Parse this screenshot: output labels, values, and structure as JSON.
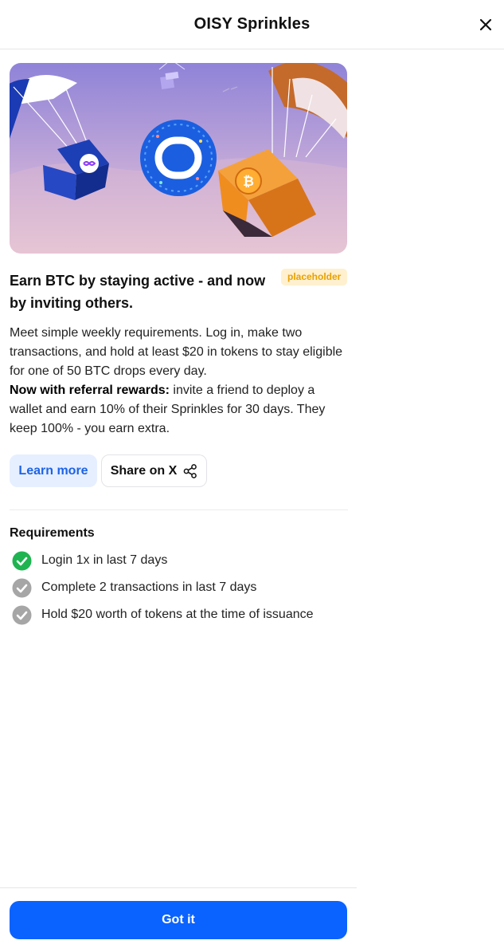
{
  "header": {
    "title": "OISY Sprinkles",
    "close_icon": "close-icon"
  },
  "hero": {
    "illustration": "parachuting-gift-boxes",
    "icons": [
      "internet-computer-logo",
      "oisy-logo",
      "bitcoin-logo"
    ]
  },
  "campaign": {
    "headline": "Earn BTC by staying active - and now by inviting others.",
    "badge": "placeholder",
    "description": "Meet simple weekly requirements. Log in, make two transactions, and hold at least $20 in tokens to stay eligible for one of 50 BTC drops every day.",
    "referral_bold": "Now with referral rewards:",
    "referral_text": " invite a friend to deploy a wallet and earn 10% of their Sprinkles for 30 days. They keep 100% - you earn extra."
  },
  "actions": {
    "learn_more": "Learn more",
    "share_on_x": "Share on X",
    "share_icon": "share-icon"
  },
  "requirements": {
    "title": "Requirements",
    "items": [
      {
        "label": "Login 1x in last 7 days",
        "status": "complete"
      },
      {
        "label": "Complete 2 transactions in last 7 days",
        "status": "pending"
      },
      {
        "label": "Hold $20 worth of tokens at the time of issuance",
        "status": "pending"
      }
    ]
  },
  "footer": {
    "got_it": "Got it"
  },
  "colors": {
    "primary": "#0a63ff",
    "learn_bg": "#e6efff",
    "badge_bg": "#fff0cf",
    "badge_text": "#e8a100",
    "complete": "#1fb451",
    "pending": "#a6a6a6"
  }
}
